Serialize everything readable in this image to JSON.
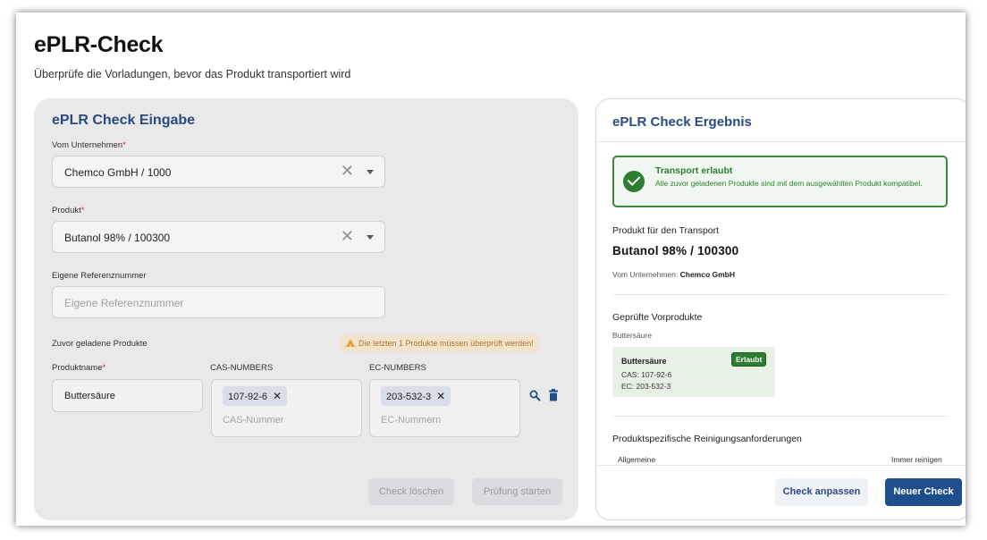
{
  "page": {
    "title": "ePLR-Check",
    "subtitle": "Überprüfe die Vorladungen, bevor das Produkt transportiert wird"
  },
  "input_panel": {
    "title": "ePLR Check Eingabe",
    "company": {
      "label": "Vom Unternehmen",
      "required_mark": "*",
      "value": "Chemco GmbH / 1000"
    },
    "product": {
      "label": "Produkt",
      "required_mark": "*",
      "value": "Butanol 98% / 100300"
    },
    "reference": {
      "label": "Eigene Referenznummer",
      "placeholder": "Eigene Referenznummer"
    },
    "previous_products": {
      "label": "Zuvor geladene Produkte",
      "warning": "Die letzten 1 Produkte müssen überprüft werden!",
      "col_name": "Produktname",
      "col_name_required": "*",
      "col_cas": "CAS-NUMBERS",
      "col_ec": "EC-NUMBERS",
      "rows": [
        {
          "name": "Buttersäure",
          "cas_chip": "107-92-6",
          "cas_placeholder": "CAS-Nummer",
          "ec_chip": "203-532-3",
          "ec_placeholder": "EC-Nummern"
        }
      ]
    },
    "buttons": {
      "clear": "Check löschen",
      "start": "Prüfung starten"
    },
    "icons": {
      "clear": "close-icon",
      "dropdown": "chevron-down-icon",
      "search": "search-icon",
      "delete": "trash-icon",
      "warning": "warning-icon"
    }
  },
  "result_panel": {
    "title": "ePLR Check Ergebnis",
    "status": {
      "title": "Transport erlaubt",
      "text": "Alle zuvor geladenen Produkte sind mit dem ausgewählten Produkt kompatibel.",
      "icon": "check-circle-icon",
      "color": "#2e7d32"
    },
    "transport_heading": "Produkt für den Transport",
    "transport_product": "Butanol 98% / 100300",
    "company_label": "Vom Unternehmen:",
    "company_value": "Chemco GmbH",
    "checked_heading": "Geprüfte Vorprodukte",
    "checked_sub": "Buttersäure",
    "card": {
      "name": "Buttersäure",
      "badge": "Erlaubt",
      "cas": "CAS: 107-92-6",
      "ec": "EC: 203-532-3"
    },
    "cleaning_heading": "Produktspezifische Reinigungsanforderungen",
    "cleaning_general": "Allgemeine",
    "cleaning_value": "Immer reinigen",
    "buttons": {
      "adjust": "Check anpassen",
      "new": "Neuer Check"
    }
  },
  "colors": {
    "accent": "#2a4a82",
    "primary_button": "#1f4e8c",
    "success": "#2e7d32",
    "warning": "#e0a032"
  }
}
